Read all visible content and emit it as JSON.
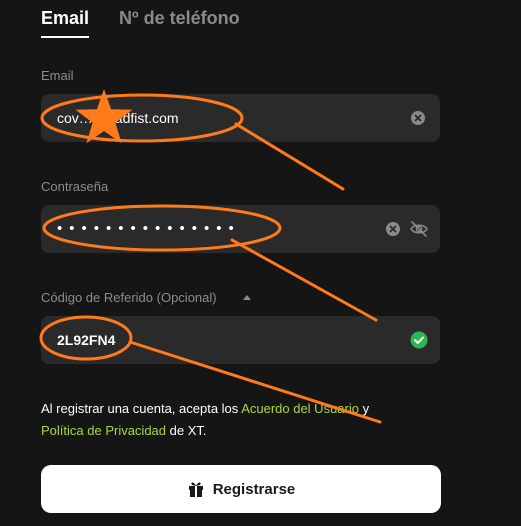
{
  "tabs": {
    "email_label": "Email",
    "phone_label": "Nº de teléfono"
  },
  "email": {
    "label": "Email",
    "value": "cov…@badfist.com"
  },
  "password": {
    "label": "Contraseña",
    "value": "•••••••••••••••"
  },
  "referral": {
    "label": "Código de Referido (Opcional)",
    "value": "2L92FN4"
  },
  "terms": {
    "prefix": "Al registrar una cuenta, acepta los ",
    "user_agreement_link": "Acuerdo del Usuario",
    "connector": " y ",
    "privacy_link": "Política de Privacidad",
    "suffix": " de XT."
  },
  "register_button_label": "Registrarse",
  "colors": {
    "background": "#151515",
    "field": "#2a2a2a",
    "accent_green": "#a6d93e",
    "success_green": "#2db84d",
    "annotation_orange": "#ff7a1a"
  },
  "icons": {
    "email_clear": "clear-icon",
    "password_clear": "clear-icon",
    "password_visibility": "eye-off-icon",
    "referral_valid": "check-circle-icon",
    "referral_toggle": "caret-up-icon",
    "register": "gift-icon"
  }
}
